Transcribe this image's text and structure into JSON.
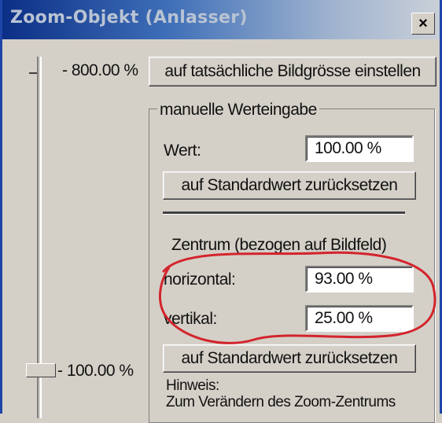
{
  "window": {
    "title": "Zoom-Objekt (Anlasser)",
    "close_glyph": "×"
  },
  "slider": {
    "max_label": "- 800.00 %",
    "current_label": "- 100.00 %"
  },
  "actual_size_button": "auf tatsächliche Bildgrösse einstellen",
  "manual": {
    "group_title": "manuelle Werteingabe",
    "value_label": "Wert:",
    "value": "100.00 %",
    "reset_button": "auf Standardwert zurücksetzen"
  },
  "center": {
    "title": "Zentrum (bezogen auf Bildfeld)",
    "horizontal_label": "horizontal:",
    "horizontal_value": "93.00 %",
    "vertical_label": "vertikal:",
    "vertical_value": "25.00 %",
    "reset_button": "auf Standardwert zurücksetzen"
  },
  "hint": {
    "title": "Hinweis:",
    "text": "Zum Verändern des Zoom-Zentrums"
  },
  "colors": {
    "annotation": "#d3242c",
    "title_start": "#0b2f86"
  }
}
